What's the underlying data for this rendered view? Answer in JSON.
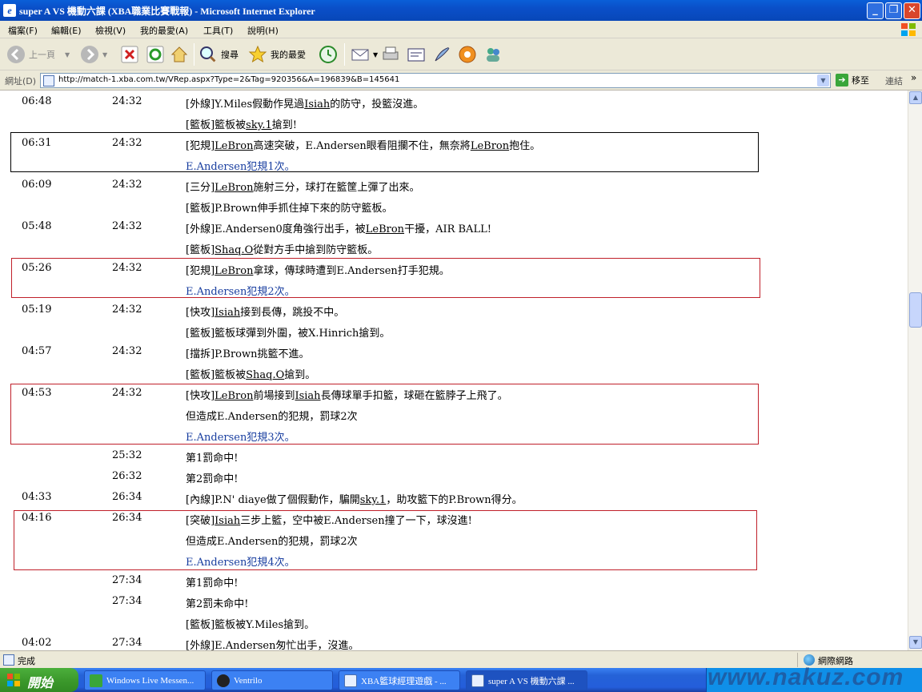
{
  "window": {
    "title": "super A VS 機動六課 (XBA職業比賽戰報) - Microsoft Internet Explorer",
    "icon_glyph": "e"
  },
  "menu": [
    "檔案(F)",
    "編輯(E)",
    "檢視(V)",
    "我的最愛(A)",
    "工具(T)",
    "說明(H)"
  ],
  "toolbar": {
    "back_label": "上一頁",
    "search_label": "搜尋",
    "favorites_label": "我的最愛"
  },
  "address": {
    "label": "網址(D)",
    "url": "http://match-1.xba.com.tw/VRep.aspx?Type=2&Tag=920356&A=196839&B=145641",
    "go_label": "移至",
    "links_label": "連結"
  },
  "log": [
    {
      "t1": "06:48",
      "t2": "24:32",
      "parts": [
        "[外線]Y.Miles假動作晃過",
        {
          "u": "Isiah"
        },
        "的防守，投籃沒進。"
      ]
    },
    {
      "t1": "",
      "t2": "",
      "parts": [
        "[籃板]籃板被",
        {
          "u": "sky.1"
        },
        "搶到!"
      ]
    },
    {
      "t1": "06:31",
      "t2": "24:32",
      "parts": [
        "[犯規]",
        {
          "u": "LeBron"
        },
        "高速突破，E.Andersen眼看阻攔不住，無奈將",
        {
          "u": "LeBron"
        },
        "抱住。"
      ]
    },
    {
      "t1": "",
      "t2": "",
      "foul": true,
      "parts": [
        "E.Andersen犯規1次。"
      ]
    },
    {
      "t1": "06:09",
      "t2": "24:32",
      "parts": [
        "[三分]",
        {
          "u": "LeBron"
        },
        "施射三分，球打在籃筐上彈了出來。"
      ]
    },
    {
      "t1": "",
      "t2": "",
      "parts": [
        "[籃板]P.Brown伸手抓住掉下來的防守籃板。"
      ]
    },
    {
      "t1": "05:48",
      "t2": "24:32",
      "parts": [
        "[外線]E.Andersen0度角強行出手，被",
        {
          "u": "LeBron"
        },
        "干擾，AIR BALL!"
      ]
    },
    {
      "t1": "",
      "t2": "",
      "parts": [
        "[籃板]",
        {
          "u": "Shaq.O"
        },
        "從對方手中搶到防守籃板。"
      ]
    },
    {
      "t1": "05:26",
      "t2": "24:32",
      "parts": [
        "[犯規]",
        {
          "u": "LeBron"
        },
        "拿球，傳球時遭到E.Andersen打手犯規。"
      ]
    },
    {
      "t1": "",
      "t2": "",
      "foul": true,
      "parts": [
        "E.Andersen犯規2次。"
      ]
    },
    {
      "t1": "05:19",
      "t2": "24:32",
      "parts": [
        "[快攻]",
        {
          "u": "Isiah"
        },
        "接到長傳，跳投不中。"
      ]
    },
    {
      "t1": "",
      "t2": "",
      "parts": [
        "[籃板]籃板球彈到外圍，被X.Hinrich搶到。"
      ]
    },
    {
      "t1": "04:57",
      "t2": "24:32",
      "parts": [
        "[擋拆]P.Brown挑籃不進。"
      ]
    },
    {
      "t1": "",
      "t2": "",
      "parts": [
        "[籃板]籃板被",
        {
          "u": "Shaq.O"
        },
        "搶到。"
      ]
    },
    {
      "t1": "04:53",
      "t2": "24:32",
      "parts": [
        "[快攻]",
        {
          "u": "LeBron"
        },
        "前場接到",
        {
          "u": "Isiah"
        },
        "長傳球單手扣籃，球砸在籃脖子上飛了。"
      ]
    },
    {
      "t1": "",
      "t2": "",
      "parts": [
        "但造成E.Andersen的犯規，罰球2次"
      ]
    },
    {
      "t1": "",
      "t2": "",
      "foul": true,
      "parts": [
        "E.Andersen犯規3次。"
      ]
    },
    {
      "t1": "",
      "t2": "25:32",
      "parts": [
        "第1罰命中!"
      ]
    },
    {
      "t1": "",
      "t2": "26:32",
      "parts": [
        "第2罰命中!"
      ]
    },
    {
      "t1": "04:33",
      "t2": "26:34",
      "parts": [
        "[內線]P.N' diaye做了個假動作，騙開",
        {
          "u": "sky.1"
        },
        "，助攻籃下的P.Brown得分。"
      ]
    },
    {
      "t1": "04:16",
      "t2": "26:34",
      "parts": [
        "[突破]",
        {
          "u": "Isiah"
        },
        "三步上籃，空中被E.Andersen撞了一下，球沒進!"
      ]
    },
    {
      "t1": "",
      "t2": "",
      "parts": [
        "但造成E.Andersen的犯規，罰球2次"
      ]
    },
    {
      "t1": "",
      "t2": "",
      "foul": true,
      "parts": [
        "E.Andersen犯規4次。"
      ]
    },
    {
      "t1": "",
      "t2": "27:34",
      "parts": [
        "第1罰命中!"
      ]
    },
    {
      "t1": "",
      "t2": "27:34",
      "parts": [
        "第2罰未命中!"
      ]
    },
    {
      "t1": "",
      "t2": "",
      "parts": [
        "[籃板]籃板被Y.Miles搶到。"
      ]
    },
    {
      "t1": "04:02",
      "t2": "27:34",
      "parts": [
        "[外線]E.Andersen匆忙出手，沒進。"
      ]
    }
  ],
  "status": {
    "text": "完成",
    "zone": "網際網路"
  },
  "taskbar": {
    "start_label": "開始",
    "tasks": [
      "Windows Live Messen...",
      "Ventrilo",
      "XBA籃球經理遊戲 - ...",
      "super A VS 機動六課 ..."
    ]
  },
  "watermark": "www.nakuz.com",
  "colors": {
    "foul_text": "#1a3fa0",
    "highlight_red": "#c0202a",
    "highlight_black": "#000000"
  }
}
